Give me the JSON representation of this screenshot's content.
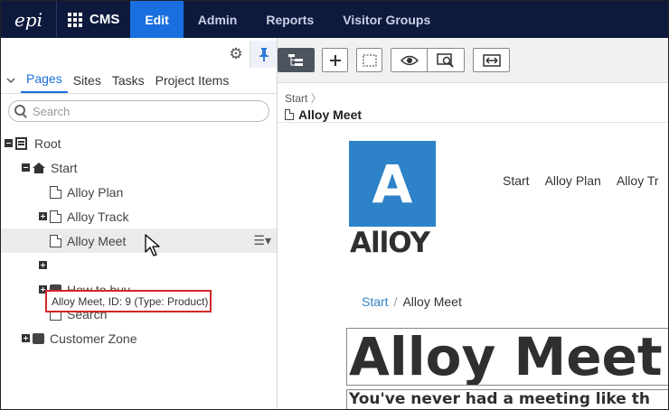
{
  "topbar": {
    "logo": "epi",
    "app_name": "CMS",
    "nav": [
      {
        "label": "Edit",
        "active": true
      },
      {
        "label": "Admin",
        "active": false
      },
      {
        "label": "Reports",
        "active": false
      },
      {
        "label": "Visitor Groups",
        "active": false
      }
    ]
  },
  "left_pane": {
    "tabs": [
      "Pages",
      "Sites",
      "Tasks",
      "Project Items"
    ],
    "active_tab": "Pages",
    "search_placeholder": "Search",
    "tree": [
      {
        "label": "Root",
        "icon": "root-icon",
        "expander": "minus",
        "level": 0
      },
      {
        "label": "Start",
        "icon": "home-icon",
        "expander": "minus",
        "level": 1
      },
      {
        "label": "Alloy Plan",
        "icon": "page-icon",
        "expander": "none",
        "level": 2
      },
      {
        "label": "Alloy Track",
        "icon": "page-icon",
        "expander": "plus",
        "level": 2
      },
      {
        "label": "Alloy Meet",
        "icon": "page-icon",
        "expander": "none",
        "level": 2,
        "selected": true
      },
      {
        "label": "",
        "icon": "",
        "expander": "plus",
        "level": 2
      },
      {
        "label": "How to buy",
        "icon": "folder-icon",
        "expander": "plus",
        "level": 2
      },
      {
        "label": "Search",
        "icon": "page-icon",
        "expander": "none",
        "level": 2
      },
      {
        "label": "Customer Zone",
        "icon": "folder-icon",
        "expander": "plus",
        "level": 1
      }
    ],
    "tooltip": "Alloy Meet, ID: 9 (Type: Product)"
  },
  "right_pane": {
    "breadcrumb": "Start",
    "page_title": "Alloy Meet",
    "preview": {
      "logo_letter": "A",
      "logo_word": "AllOY",
      "site_nav": [
        "Start",
        "Alloy Plan",
        "Alloy Tr"
      ],
      "crumb_home": "Start",
      "crumb_sep": "/",
      "crumb_current": "Alloy Meet",
      "heading": "Alloy Meet",
      "subheading": "You've never had a meeting like th"
    }
  },
  "colors": {
    "topbar_bg": "#0e1a3d",
    "active_nav": "#1a6fe0",
    "alloy_blue": "#2d82c8",
    "tooltip_border": "#d3262b"
  }
}
